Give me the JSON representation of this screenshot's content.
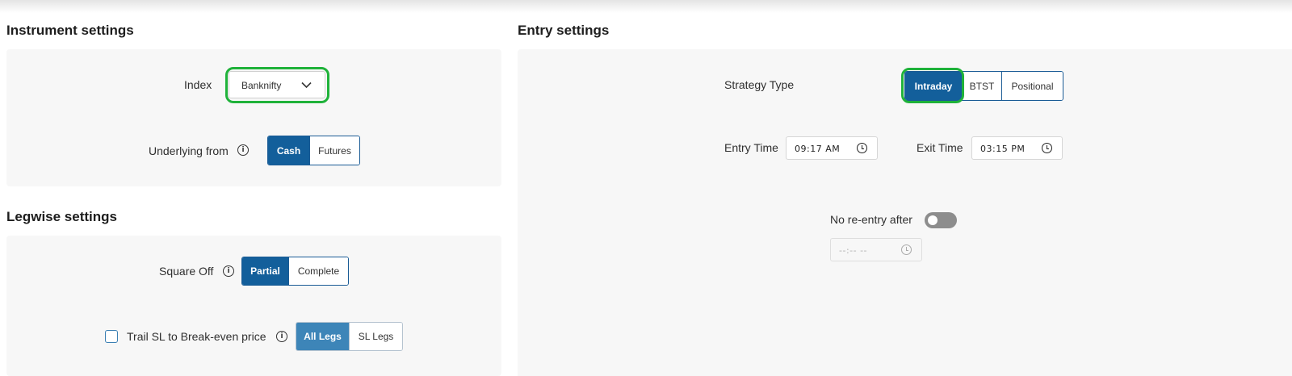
{
  "instrument": {
    "title": "Instrument settings",
    "index_label": "Index",
    "index_value": "Banknifty",
    "underlying_label": "Underlying from",
    "underlying_options": [
      "Cash",
      "Futures"
    ],
    "underlying_selected": "Cash"
  },
  "legwise": {
    "title": "Legwise settings",
    "square_off_label": "Square Off",
    "square_off_options": [
      "Partial",
      "Complete"
    ],
    "square_off_selected": "Partial",
    "trail_label": "Trail SL to Break-even price",
    "trail_checked": false,
    "trail_options": [
      "All Legs",
      "SL Legs"
    ],
    "trail_selected": "All Legs"
  },
  "entry": {
    "title": "Entry settings",
    "strategy_label": "Strategy Type",
    "strategy_options": [
      "Intraday",
      "BTST",
      "Positional"
    ],
    "strategy_selected": "Intraday",
    "entry_time_label": "Entry Time",
    "entry_time_value": "09:17 AM",
    "exit_time_label": "Exit Time",
    "exit_time_value": "03:15 PM",
    "no_reentry_label": "No re-entry after",
    "no_reentry_enabled": false,
    "no_reentry_time_placeholder": "--:-- --"
  },
  "colors": {
    "primary": "#135f9b",
    "primary_light": "#3d85b8",
    "highlight_ring": "#1fb23a",
    "panel_bg": "#f7f7f7",
    "toggle_off": "#8d8d8d"
  },
  "icons": [
    "info-icon",
    "chevron-down-icon",
    "clock-icon"
  ]
}
